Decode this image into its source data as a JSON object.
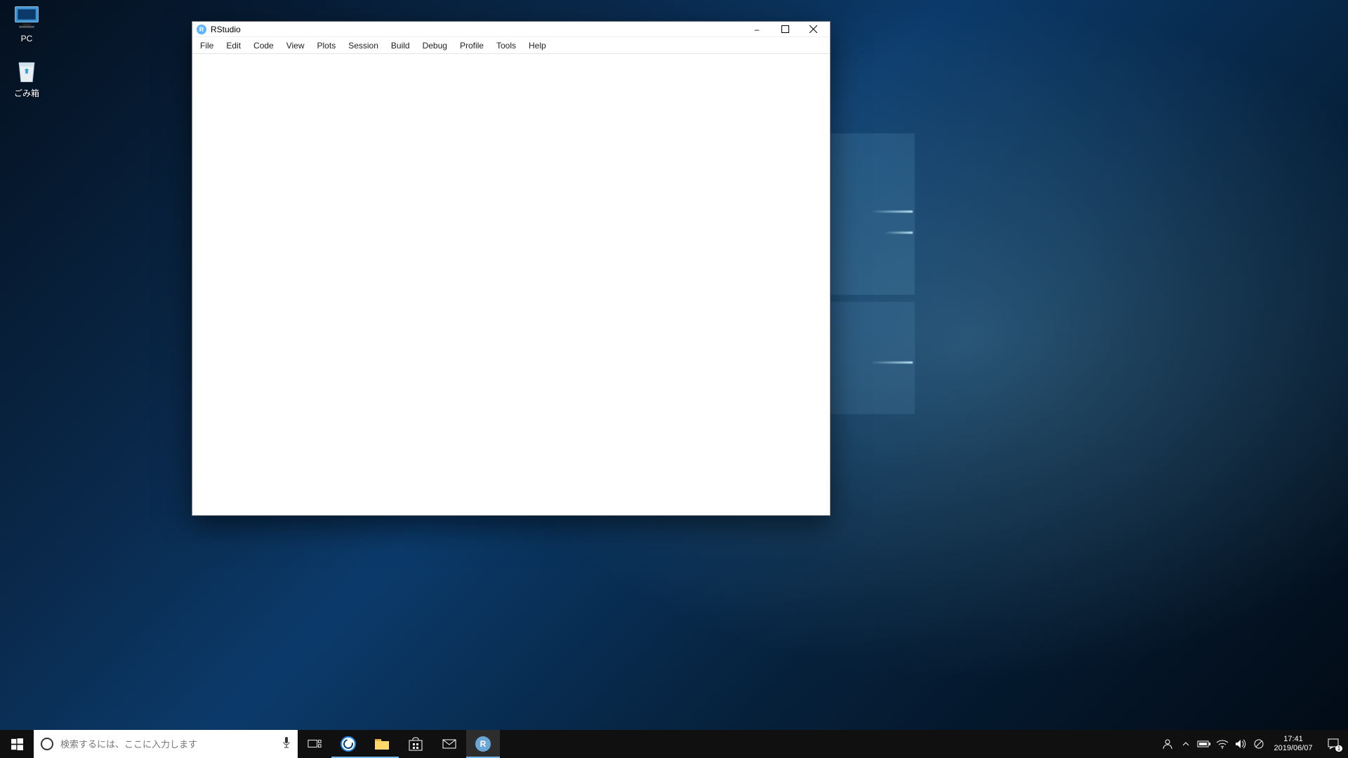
{
  "desktop_icons": [
    {
      "name": "pc",
      "label": "PC"
    },
    {
      "name": "recycle-bin",
      "label": "ごみ箱"
    }
  ],
  "window": {
    "title": "RStudio",
    "menu": [
      "File",
      "Edit",
      "Code",
      "View",
      "Plots",
      "Session",
      "Build",
      "Debug",
      "Profile",
      "Tools",
      "Help"
    ],
    "controls": {
      "minimize": "–",
      "maximize": "□",
      "close": "×"
    }
  },
  "taskbar": {
    "search_placeholder": "検索するには、ここに入力します",
    "apps": [
      {
        "name": "edge",
        "label": "Edge",
        "active": false,
        "running": true
      },
      {
        "name": "file-explorer",
        "label": "File Explorer",
        "active": false,
        "running": true
      },
      {
        "name": "ms-store",
        "label": "Microsoft Store",
        "active": false,
        "running": false
      },
      {
        "name": "mail",
        "label": "Mail",
        "active": false,
        "running": false
      },
      {
        "name": "rstudio",
        "label": "RStudio",
        "active": true,
        "running": true
      }
    ]
  },
  "tray": {
    "time": "17:41",
    "date": "2019/06/07",
    "notification_count": "1"
  }
}
